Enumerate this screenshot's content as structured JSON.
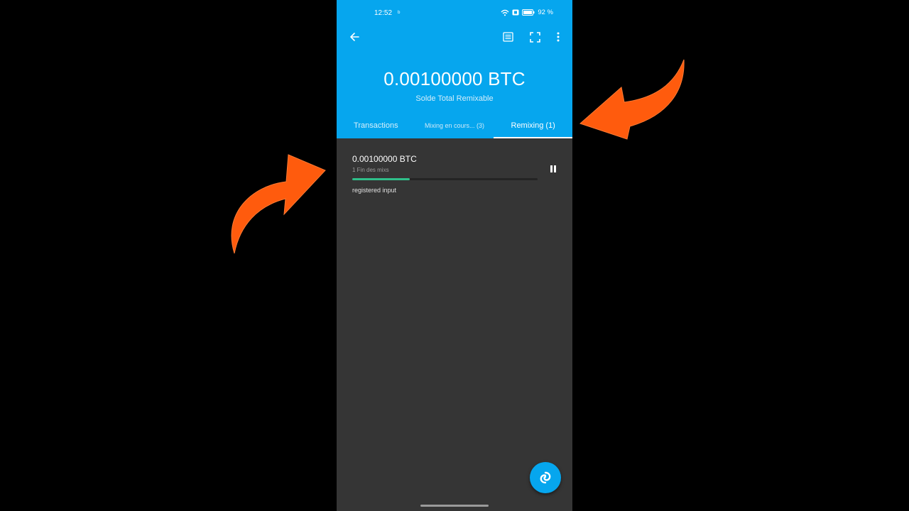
{
  "status_bar": {
    "time": "12:52",
    "left_icon": "ᵇ",
    "battery_text": "92 %"
  },
  "toolbar": {
    "back_icon": "arrow-back-icon",
    "list_icon": "list-icon",
    "scan_icon": "scan-icon",
    "more_icon": "more-vert-icon"
  },
  "balance": {
    "amount": "0.00100000 BTC",
    "label": "Solde Total Remixable"
  },
  "tabs": [
    {
      "label": "Transactions",
      "active": false
    },
    {
      "label": "Mixing en cours... (3)",
      "active": false
    },
    {
      "label": "Remixing (1)",
      "active": true
    }
  ],
  "mix_item": {
    "amount": "0.00100000 BTC",
    "subtitle": "1 Fin des mixs",
    "progress": 0.31,
    "status": "registered input"
  },
  "colors": {
    "header": "#06a6ee",
    "body": "#353535",
    "progress": "#2fbf8a",
    "annotation_arrow": "#ff5b0d"
  }
}
